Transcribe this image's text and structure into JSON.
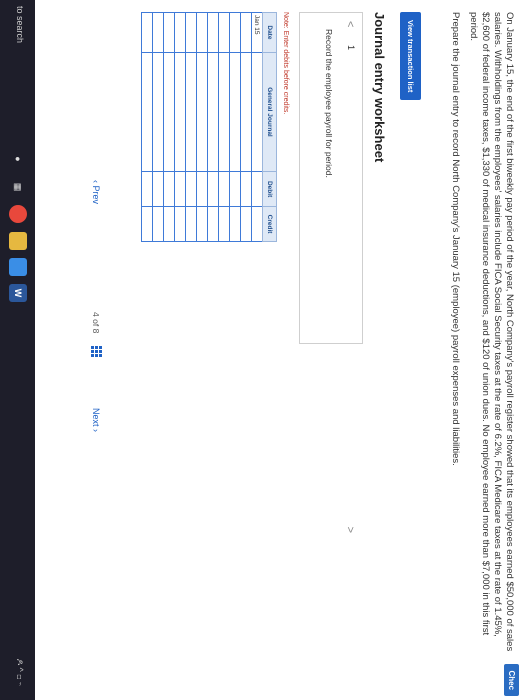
{
  "problem": {
    "paragraph1": "On January 15, the end of the first biweekly pay period of the year, North Company's payroll register showed that its employees earned $50,000 of sales salaries. Withholdings from the employees' salaries include FICA Social Security taxes at the rate of 6.2%, FICA Medicare taxes at the rate of 1.45%, $2,600 of federal income taxes, $1,330 of medical insurance deductions, and $120 of union dues. No employee earned more than $7,000 in this first period.",
    "paragraph2": "Prepare the journal entry to record North Company's January 15 (employee) payroll expenses and liabilities."
  },
  "check_label": "Chec",
  "view_transaction_label": "View transaction list",
  "worksheet": {
    "title": "Journal entry worksheet",
    "left_arrow": "<",
    "right_arrow": ">",
    "entry_number": "1",
    "instruction": "Record the employee payroll for period."
  },
  "note": "Note: Enter debits before credits.",
  "journal": {
    "headers": [
      "Date",
      "General Journal",
      "Debit",
      "Credit"
    ],
    "rows": [
      [
        "Jan 15",
        "",
        "",
        ""
      ],
      [
        "",
        "",
        "",
        ""
      ],
      [
        "",
        "",
        "",
        ""
      ],
      [
        "",
        "",
        "",
        ""
      ],
      [
        "",
        "",
        "",
        ""
      ],
      [
        "",
        "",
        "",
        ""
      ],
      [
        "",
        "",
        "",
        ""
      ],
      [
        "",
        "",
        "",
        ""
      ],
      [
        "",
        "",
        "",
        ""
      ],
      [
        "",
        "",
        "",
        ""
      ],
      [
        "",
        "",
        "",
        ""
      ]
    ]
  },
  "nav": {
    "prev_label": "Prev",
    "page_current": "4",
    "page_of": "of",
    "page_total": "8",
    "next_label": "Next"
  },
  "taskbar": {
    "search_text": "to search",
    "word_label": "W",
    "tray_text": "ዶ ^ ◻ ⌁"
  }
}
